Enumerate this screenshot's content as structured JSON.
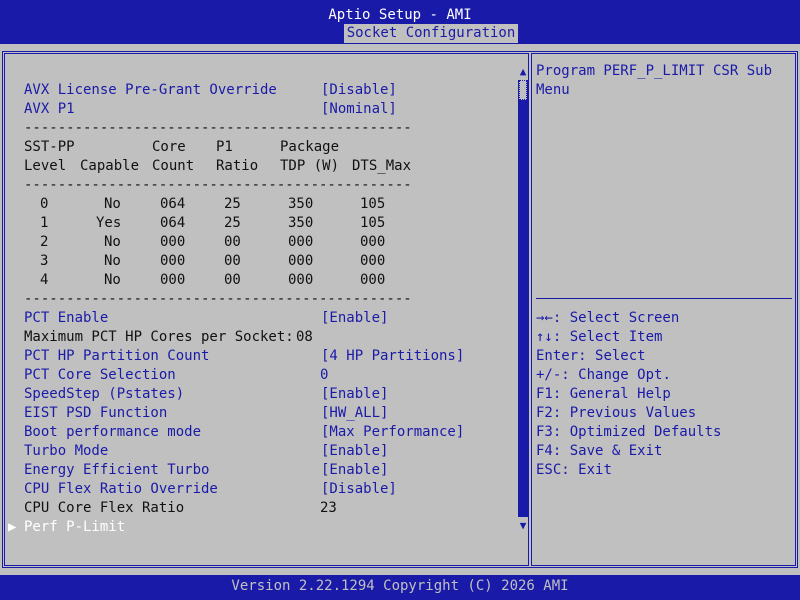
{
  "header": {
    "title": "Aptio Setup - AMI",
    "active_tab": "Socket Configuration"
  },
  "settings": [
    {
      "label": "AVX License Pre-Grant Override",
      "value": "[Disable]"
    },
    {
      "label": "AVX P1",
      "value": "[Nominal]"
    }
  ],
  "sst_table": {
    "divider": "----------------------------------------------",
    "headers": [
      {
        "line1": "SST-PP",
        "line2": "Level"
      },
      {
        "line1": "",
        "line2": "Capable"
      },
      {
        "line1": "Core",
        "line2": "Count"
      },
      {
        "line1": "P1",
        "line2": "Ratio"
      },
      {
        "line1": "Package",
        "line2": "TDP (W)"
      },
      {
        "line1": "",
        "line2": "DTS_Max"
      }
    ],
    "rows": [
      [
        "0",
        "No",
        "064",
        "25",
        "350",
        "105"
      ],
      [
        "1",
        "Yes",
        "064",
        "25",
        "350",
        "105"
      ],
      [
        "2",
        "No",
        "000",
        "00",
        "000",
        "000"
      ],
      [
        "3",
        "No",
        "000",
        "00",
        "000",
        "000"
      ],
      [
        "4",
        "No",
        "000",
        "00",
        "000",
        "000"
      ]
    ]
  },
  "items": [
    {
      "label": "PCT Enable",
      "value": "[Enable]"
    },
    {
      "label": "Maximum PCT HP Cores per Socket:",
      "value": "08"
    },
    {
      "label": "PCT HP Partition Count",
      "value": "[4 HP Partitions]"
    },
    {
      "label": "PCT Core Selection",
      "value": "0"
    },
    {
      "label": "SpeedStep (Pstates)",
      "value": "[Enable]"
    },
    {
      "label": "EIST PSD Function",
      "value": "[HW_ALL]"
    },
    {
      "label": "Boot performance mode",
      "value": "[Max Performance]"
    },
    {
      "label": "Turbo Mode",
      "value": "[Enable]"
    },
    {
      "label": "Energy Efficient Turbo",
      "value": "[Enable]"
    },
    {
      "label": "CPU Flex Ratio Override",
      "value": "[Disable]"
    },
    {
      "label": "CPU Core Flex Ratio",
      "value": "23"
    },
    {
      "label": "Perf P-Limit",
      "value": ""
    }
  ],
  "help": {
    "line1": "Program PERF_P_LIMIT CSR Sub",
    "line2": "Menu"
  },
  "keys": [
    {
      "key": "→←",
      "desc": ": Select Screen"
    },
    {
      "key": "↑↓",
      "desc": ": Select Item"
    },
    {
      "key": "Enter",
      "desc": ": Select"
    },
    {
      "key": "+/-",
      "desc": ": Change Opt."
    },
    {
      "key": "F1",
      "desc": ": General Help"
    },
    {
      "key": "F2",
      "desc": ": Previous Values"
    },
    {
      "key": "F3",
      "desc": ": Optimized Defaults"
    },
    {
      "key": "F4",
      "desc": ": Save & Exit"
    },
    {
      "key": "ESC",
      "desc": ": Exit"
    }
  ],
  "footer": {
    "version": "Version 2.22.1294 Copyright (C) 2026 AMI"
  },
  "colors": {
    "background": "#c0c0c0",
    "accent": "#1a1aa8",
    "highlight": "#ffffff",
    "text": "#111111"
  },
  "icons": {
    "submenu": "right-triangle-icon",
    "scroll_up": "up-triangle-icon",
    "scroll_down": "down-triangle-icon"
  }
}
